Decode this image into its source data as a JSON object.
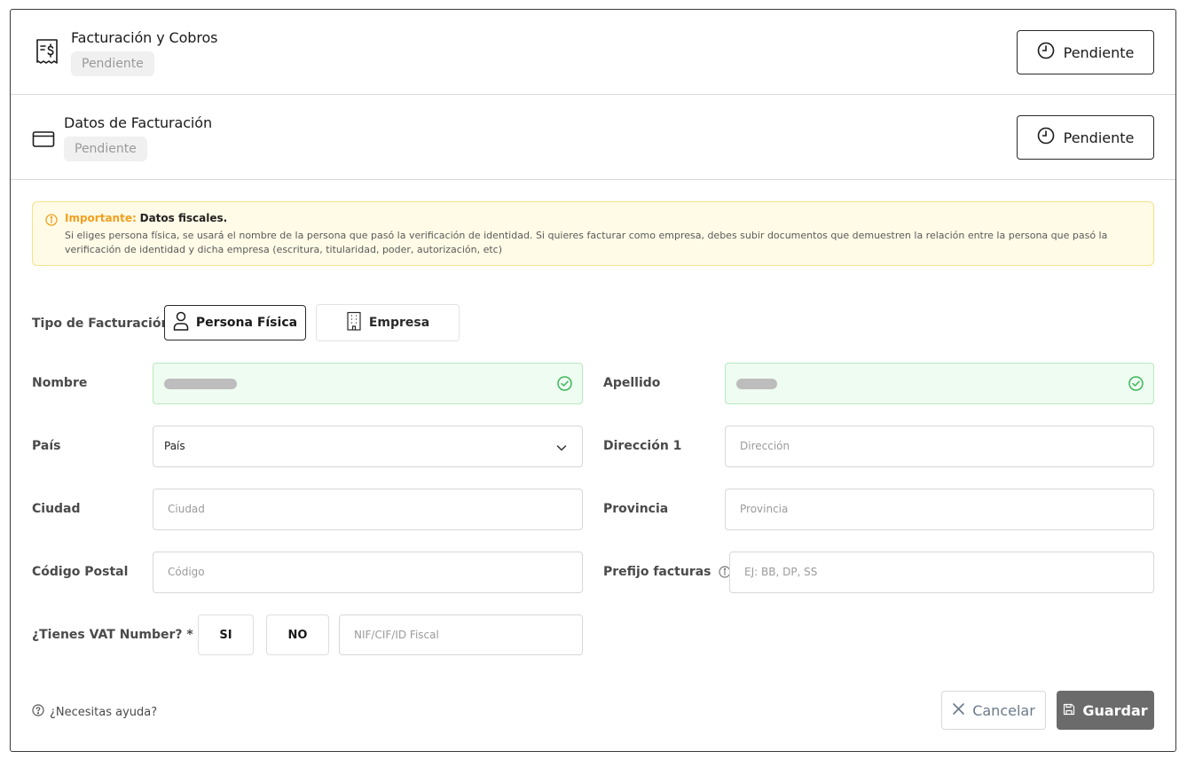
{
  "sections": [
    {
      "title": "Facturación y Cobros",
      "badge": "Pendiente",
      "status": "Pendiente",
      "icon": "receipt-dollar-icon"
    },
    {
      "title": "Datos de Facturación",
      "badge": "Pendiente",
      "status": "Pendiente",
      "icon": "credit-card-icon"
    }
  ],
  "alert": {
    "highlight": "Importante:",
    "title": "Datos fiscales.",
    "body": "Si eliges persona física, se usará el nombre de la persona que pasó la verificación de identidad. Si quieres facturar como empresa, debes subir documentos que demuestren la relación entre la persona que pasó la verificación de identidad y dicha empresa (escritura, titularidad, poder, autorización, etc)"
  },
  "billing_type": {
    "label": "Tipo de Facturación",
    "options": [
      "Persona Física",
      "Empresa"
    ],
    "selected": "Persona Física"
  },
  "form": {
    "nombre": {
      "label": "Nombre",
      "value_hidden": true
    },
    "apellido": {
      "label": "Apellido",
      "value_hidden": true
    },
    "pais": {
      "label": "País",
      "value": "País"
    },
    "direccion": {
      "label": "Dirección 1",
      "placeholder": "Dirección"
    },
    "ciudad": {
      "label": "Ciudad",
      "placeholder": "Ciudad"
    },
    "provincia": {
      "label": "Provincia",
      "placeholder": "Provincia"
    },
    "codigo_postal": {
      "label": "Código Postal",
      "placeholder": "Código"
    },
    "prefijo": {
      "label": "Prefijo facturas",
      "placeholder": "EJ: BB, DP, SS"
    },
    "vat": {
      "label": "¿Tienes VAT Number? *",
      "yes": "SI",
      "no": "NO",
      "placeholder": "NIF/CIF/ID Fiscal"
    }
  },
  "footer": {
    "help": "¿Necesitas ayuda?",
    "cancel": "Cancelar",
    "save": "Guardar"
  },
  "colors": {
    "alert_bg": "#fffbe6",
    "alert_highlight": "#f0a020",
    "valid_bg": "#effcf1",
    "valid_check": "#3cb75a",
    "save_bg": "#6b6b6b"
  }
}
